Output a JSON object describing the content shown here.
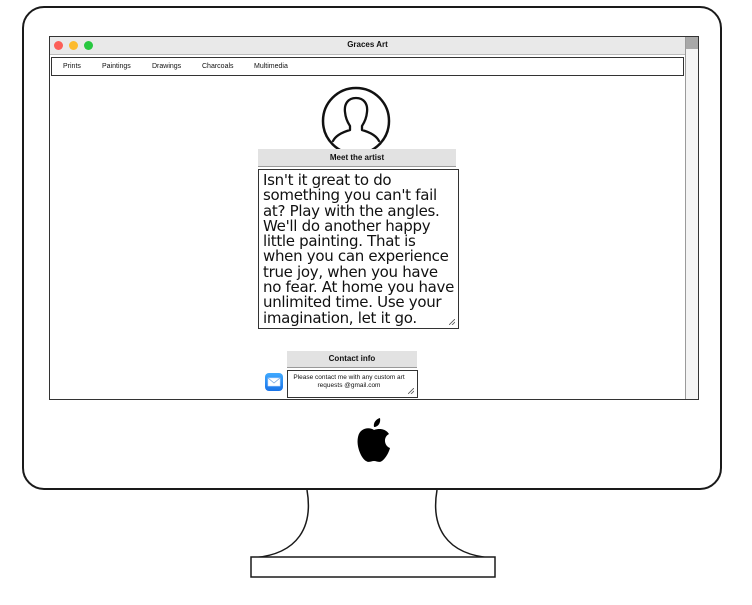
{
  "window": {
    "title": "Graces Art"
  },
  "nav": {
    "items": [
      "Prints",
      "Paintings",
      "Drawings",
      "Charcoals",
      "Multimedia"
    ]
  },
  "about": {
    "header": "Meet the artist",
    "bio": "Isn't it great to do something you can't fail at? Play with the angles. We'll do another happy little painting. That is when you can experience true joy, when you have no fear. At home you have unlimited time. Use your imagination, let it go."
  },
  "contact": {
    "header": "Contact info",
    "text": "Please contact me with any custom art requests @gmail.com"
  },
  "icons": {
    "avatar": "person-silhouette-icon",
    "mail": "mail-icon",
    "brand": "apple-logo"
  },
  "colors": {
    "close": "#fc5f57",
    "minimize": "#fdbb2e",
    "maximize": "#28c840",
    "mail_icon": "#1a73e8"
  }
}
